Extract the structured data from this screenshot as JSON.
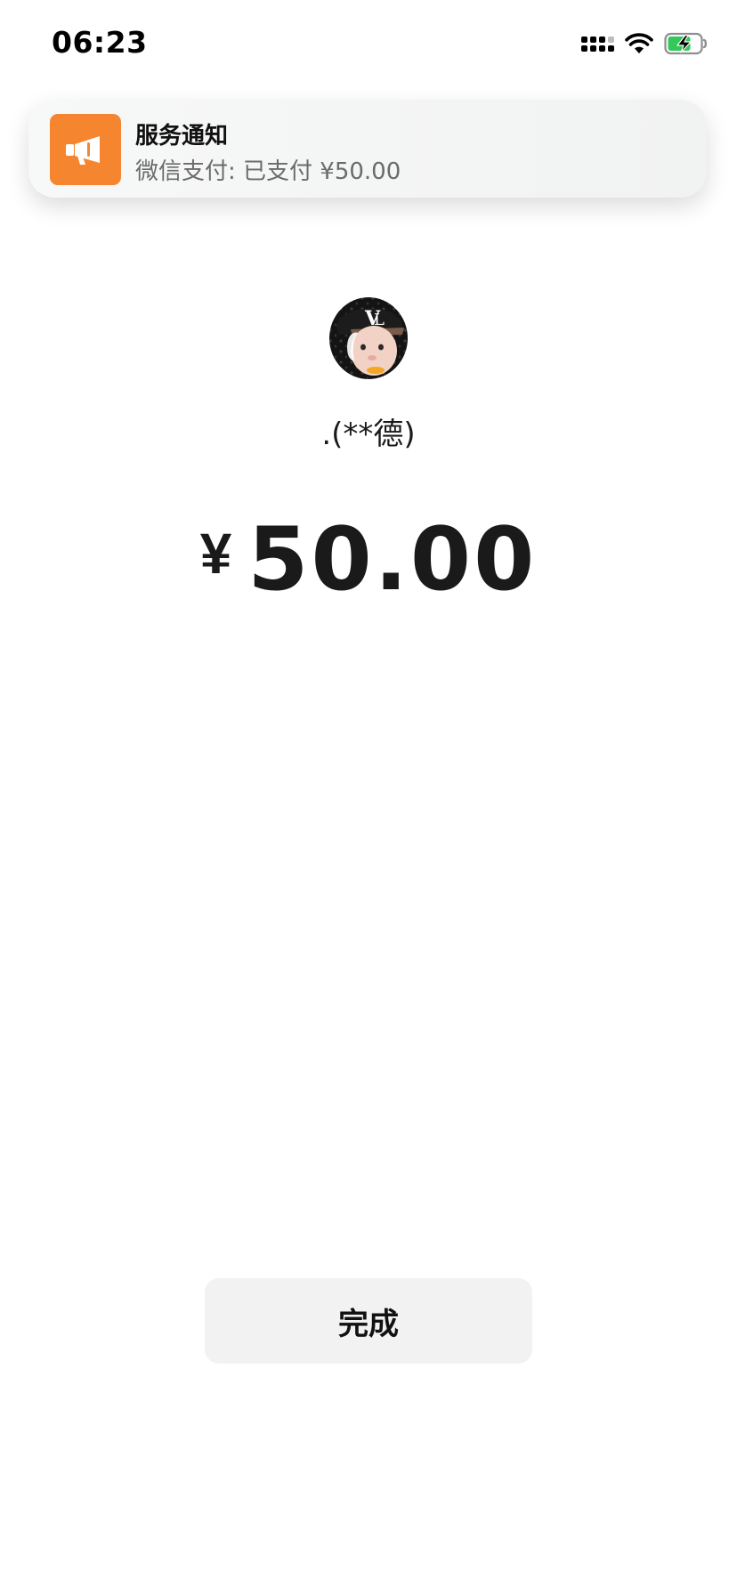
{
  "status_bar": {
    "time": "06:23",
    "icons": [
      "cellular-signal-icon",
      "wifi-icon",
      "battery-charging-icon"
    ],
    "battery_color": "#34c759"
  },
  "notification": {
    "app_icon": "megaphone-icon",
    "icon_color": "#f5852e",
    "title": "服务通知",
    "body": "微信支付: 已支付 ¥50.00"
  },
  "payee": {
    "avatar": "payee-avatar-image",
    "name": ".(**德)"
  },
  "payment": {
    "currency": "¥",
    "amount": "50.00"
  },
  "actions": {
    "done_label": "完成"
  }
}
